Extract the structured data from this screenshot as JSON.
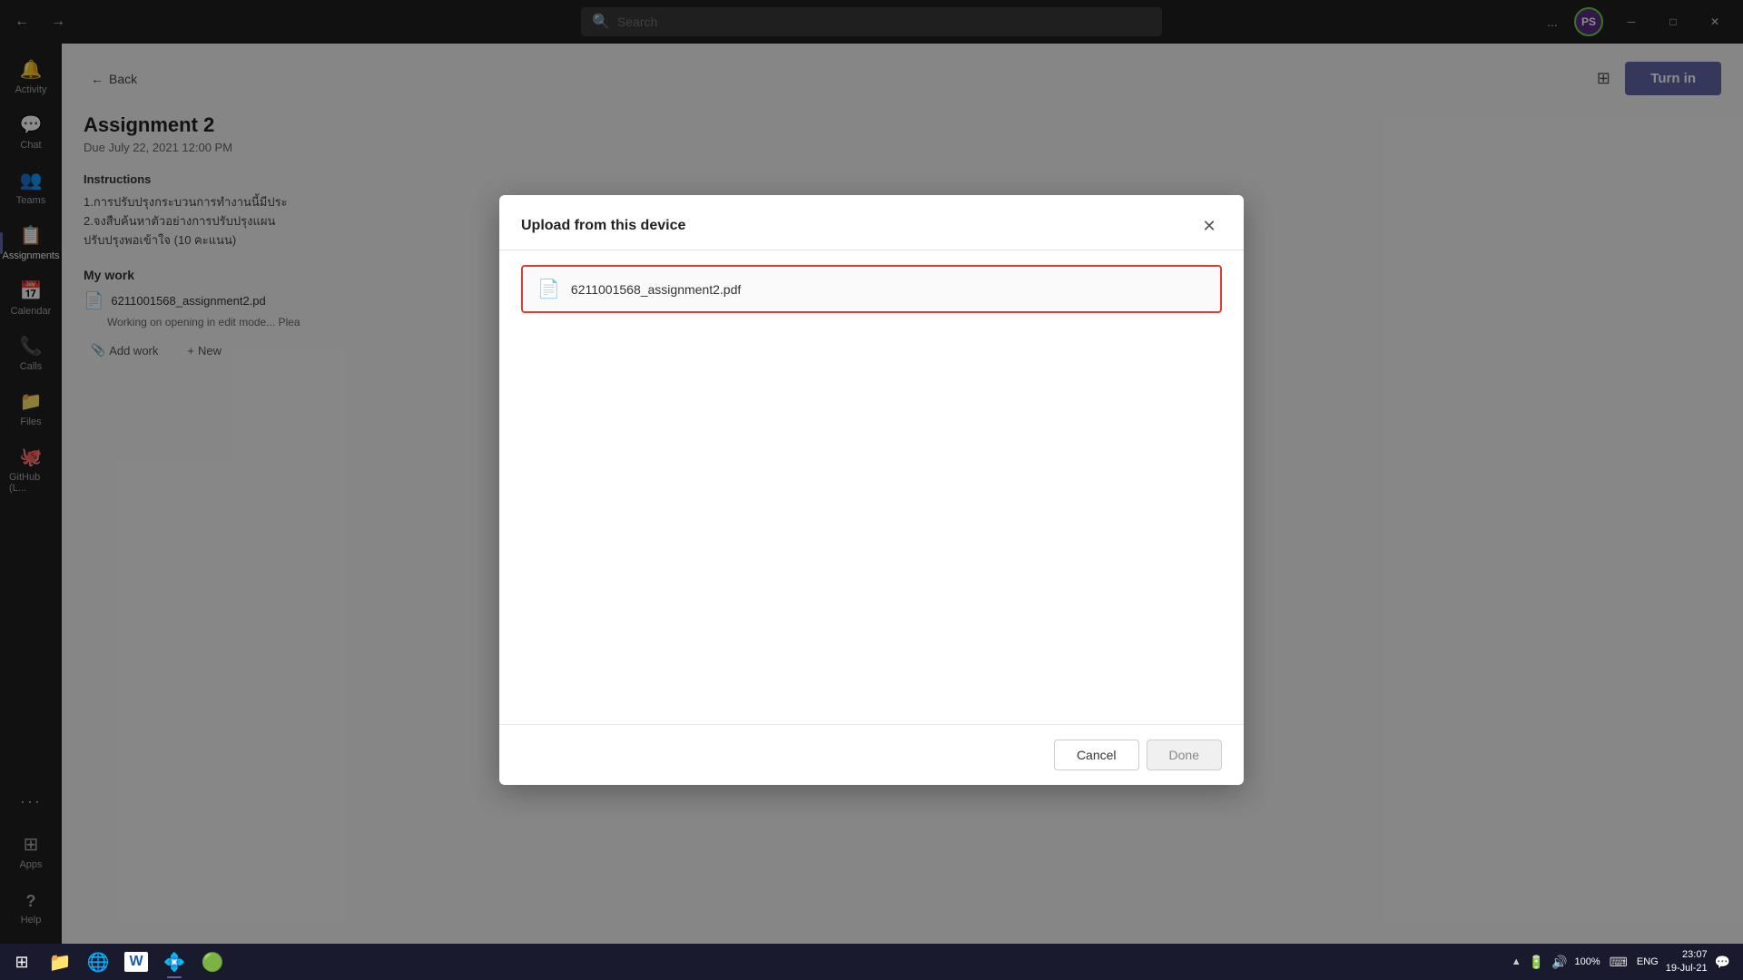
{
  "titlebar": {
    "search_placeholder": "Search",
    "more_options_label": "...",
    "avatar_initials": "PS",
    "minimize_label": "─",
    "maximize_label": "□",
    "close_label": "✕"
  },
  "sidebar": {
    "items": [
      {
        "id": "activity",
        "label": "Activity",
        "icon": "🔔"
      },
      {
        "id": "chat",
        "label": "Chat",
        "icon": "💬"
      },
      {
        "id": "teams",
        "label": "Teams",
        "icon": "👥"
      },
      {
        "id": "assignments",
        "label": "Assignments",
        "icon": "📋",
        "active": true
      },
      {
        "id": "calendar",
        "label": "Calendar",
        "icon": "📅"
      },
      {
        "id": "calls",
        "label": "Calls",
        "icon": "📞"
      },
      {
        "id": "files",
        "label": "Files",
        "icon": "📁"
      },
      {
        "id": "github",
        "label": "GitHub (L...",
        "icon": "🐙"
      }
    ],
    "bottom_items": [
      {
        "id": "more",
        "label": "...",
        "icon": "···"
      },
      {
        "id": "apps",
        "label": "Apps",
        "icon": "⊞"
      },
      {
        "id": "help",
        "label": "Help",
        "icon": "?"
      }
    ]
  },
  "content": {
    "back_label": "Back",
    "assignment_title": "Assignment 2",
    "due_date": "Due July 22, 2021 12:00 PM",
    "instructions_label": "Instructions",
    "instructions_text": "1.การปรับปรุงกระบวนการทำงานนี้มีประ\n2.จงสืบค้นหาตัวอย่างการปรับปรุงแผน\nปรับปรุงพอเข้าใจ (10 คะแนน)",
    "my_work_label": "My work",
    "file_name": "6211001568_assignment2.pd",
    "file_status": "Working on opening in edit mode... Plea",
    "add_work_label": "Add work",
    "new_label": "New",
    "turn_in_label": "Turn in"
  },
  "dialog": {
    "title": "Upload from this device",
    "close_icon": "✕",
    "file": {
      "name": "6211001568_assignment2.pdf",
      "icon": "pdf"
    },
    "cancel_label": "Cancel",
    "done_label": "Done"
  },
  "taskbar": {
    "start_icon": "⊞",
    "apps": [
      {
        "id": "explorer",
        "icon": "📁",
        "active": false
      },
      {
        "id": "chrome",
        "icon": "🌐",
        "active": false
      },
      {
        "id": "word",
        "icon": "W",
        "active": false,
        "color": "#1e5baa"
      },
      {
        "id": "teams",
        "icon": "T",
        "active": true,
        "color": "#5558a6"
      },
      {
        "id": "chrome2",
        "icon": "G",
        "active": false,
        "color": "#1aa260"
      }
    ],
    "sys_tray": {
      "battery": "100%",
      "time": "23:07",
      "date": "19-Jul-21",
      "lang": "ENG"
    }
  }
}
